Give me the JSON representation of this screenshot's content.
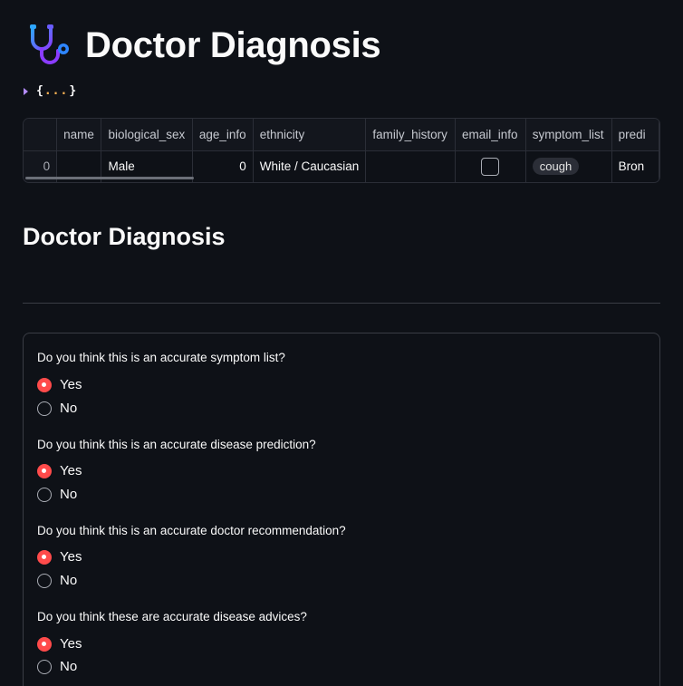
{
  "page": {
    "title": "Doctor Diagnosis",
    "icon": "stethoscope-icon"
  },
  "json_viewer": {
    "open_brace": "{",
    "dots": "...",
    "close_brace": "}"
  },
  "table": {
    "columns": [
      "",
      "name",
      "biological_sex",
      "age_info",
      "ethnicity",
      "family_history",
      "email_info",
      "symptom_list",
      "predi"
    ],
    "row": {
      "index": "0",
      "name": "",
      "biological_sex": "Male",
      "age_info": "0",
      "ethnicity": "White / Caucasian",
      "family_history": "",
      "email_info": false,
      "symptom": "cough",
      "prediction": "Bron"
    }
  },
  "section": {
    "title": "Doctor Diagnosis"
  },
  "form": {
    "questions": [
      {
        "label": "Do you think this is an accurate symptom list?",
        "options": [
          "Yes",
          "No"
        ],
        "selected": "Yes"
      },
      {
        "label": "Do you think this is an accurate disease prediction?",
        "options": [
          "Yes",
          "No"
        ],
        "selected": "Yes"
      },
      {
        "label": "Do you think this is an accurate doctor recommendation?",
        "options": [
          "Yes",
          "No"
        ],
        "selected": "Yes"
      },
      {
        "label": "Do you think these are accurate disease advices?",
        "options": [
          "Yes",
          "No"
        ],
        "selected": "Yes"
      }
    ]
  },
  "colors": {
    "background": "#0e1117",
    "accent_radio": "#ff4b4b",
    "json_dots": "#ffb454",
    "json_caret": "#b58cff",
    "icon_gradient_start": "#2ea6ff",
    "icon_gradient_end": "#8a3cff"
  }
}
